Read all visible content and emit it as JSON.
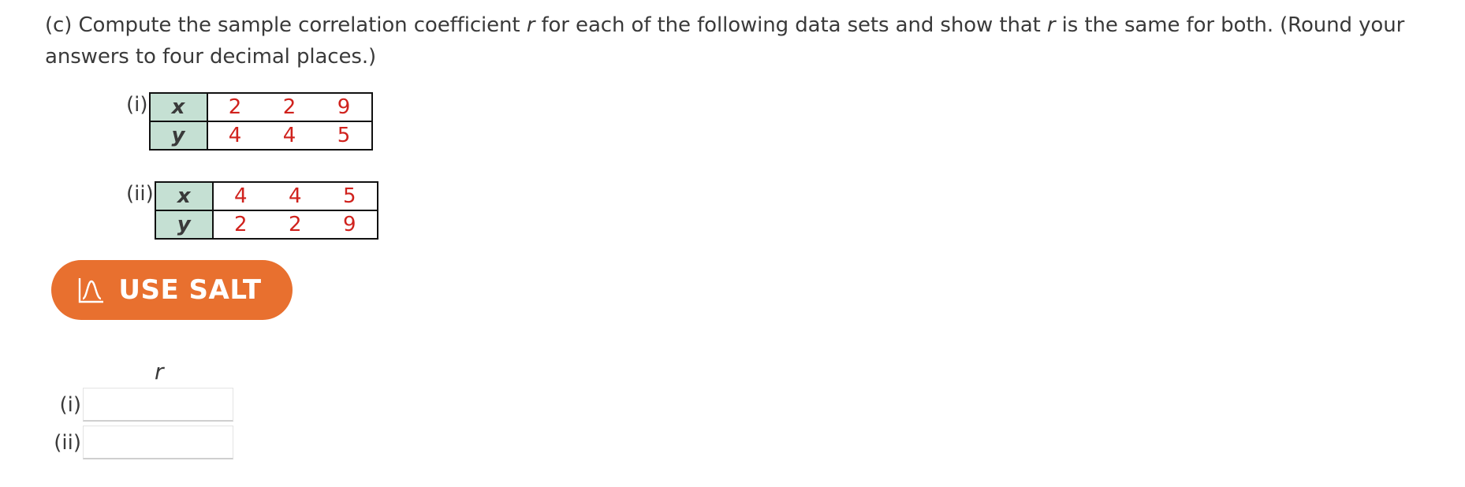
{
  "question": {
    "part": "(c)",
    "text_before_r1": "Compute the sample correlation coefficient ",
    "var_r1": "r",
    "text_between": " for each of the following data sets and show that ",
    "var_r2": "r",
    "text_after": " is the same for both. (Round your answers to four decimal places.)"
  },
  "datasets": [
    {
      "label": "(i)",
      "rows": [
        {
          "var": "x",
          "values": [
            "2",
            "2",
            "9"
          ]
        },
        {
          "var": "y",
          "values": [
            "4",
            "4",
            "5"
          ]
        }
      ]
    },
    {
      "label": "(ii)",
      "rows": [
        {
          "var": "x",
          "values": [
            "4",
            "4",
            "5"
          ]
        },
        {
          "var": "y",
          "values": [
            "2",
            "2",
            "9"
          ]
        }
      ]
    }
  ],
  "salt_button": {
    "label": "USE SALT",
    "icon": "bell-curve-icon",
    "color": "#e8702f"
  },
  "answers": {
    "column_header": "r",
    "rows": [
      {
        "label": "(i)",
        "value": "",
        "placeholder": ""
      },
      {
        "label": "(ii)",
        "value": "",
        "placeholder": ""
      }
    ]
  },
  "colors": {
    "text": "#3a3a3a",
    "data_value": "#d0221d",
    "var_cell_bg": "#c5e0d3"
  }
}
